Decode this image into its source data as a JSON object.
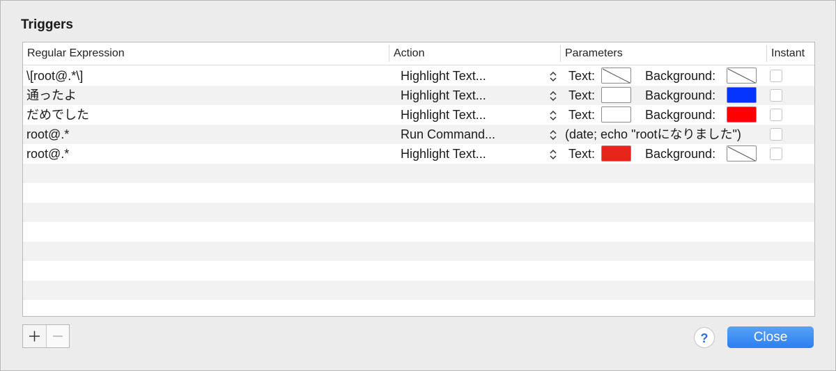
{
  "dialog": {
    "title": "Triggers"
  },
  "table": {
    "columns": [
      "Regular Expression",
      "Action",
      "Parameters",
      "Instant"
    ],
    "text_label": "Text:",
    "background_label": "Background:",
    "rows": [
      {
        "regex": "\\[root@.*\\]",
        "action": "Highlight Text...",
        "params": {
          "type": "colors",
          "text_color": null,
          "background_color": null
        },
        "instant": false
      },
      {
        "regex": "通ったよ",
        "action": "Highlight Text...",
        "params": {
          "type": "colors",
          "text_color": "#ffffff",
          "background_color": "#0433ff"
        },
        "instant": false
      },
      {
        "regex": "だめでした",
        "action": "Highlight Text...",
        "params": {
          "type": "colors",
          "text_color": "#ffffff",
          "background_color": "#ff0000"
        },
        "instant": false
      },
      {
        "regex": "root@.*",
        "action": "Run Command...",
        "params": {
          "type": "command",
          "command": "(date; echo \"rootになりました\")"
        },
        "instant": false
      },
      {
        "regex": "root@.*",
        "action": "Highlight Text...",
        "params": {
          "type": "colors",
          "text_color": "#e6251b",
          "background_color": null
        },
        "instant": false
      }
    ]
  },
  "footer": {
    "add_symbol": "+",
    "remove_symbol": "−",
    "help_symbol": "?",
    "close_label": "Close",
    "close_color": "#3b8bf2"
  }
}
